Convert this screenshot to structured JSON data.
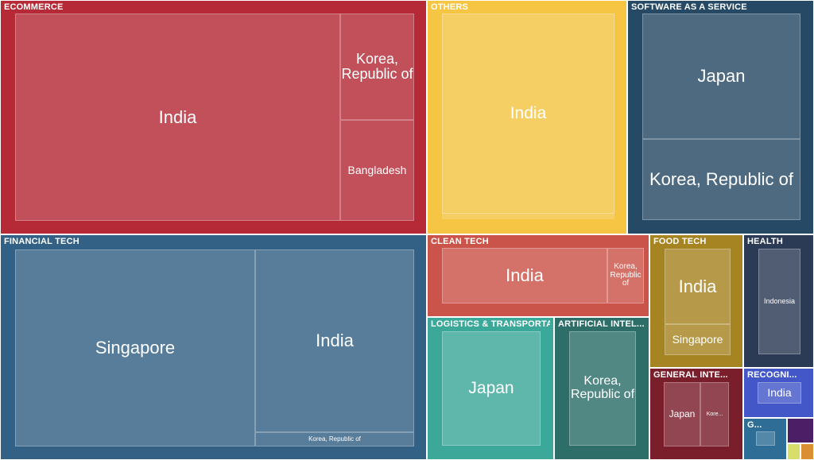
{
  "chart_data": {
    "type": "treemap",
    "colors": {
      "ECOMMERCE": "#b52a36",
      "OTHERS": "#f5c543",
      "SOFTWARE AS A SERVICE": "#264a66",
      "FINANCIAL TECH": "#336186",
      "CLEAN TECH": "#cb544a",
      "FOOD TECH": "#a68422",
      "HEALTH": "#2b3a55",
      "LOGISTICS & TRANSPORTATION": "#3ca89a",
      "ARTIFICIAL INTELLIGENCE": "#2d6e68",
      "GENERAL INTERNET": "#7b1e2c",
      "RECOGNITION": "#4357c9",
      "G": "#2e6e96",
      "PURPLE": "#4b1e66",
      "LIME": "#d7df6a",
      "ORANGE": "#d98f32"
    },
    "groups": [
      {
        "key": "ECOMMERCE",
        "title": "ECOMMERCE",
        "leaves": [
          {
            "label": "India"
          },
          {
            "label": "Korea, Republic of"
          },
          {
            "label": "Bangladesh"
          }
        ]
      },
      {
        "key": "OTHERS",
        "title": "OTHERS",
        "leaves": [
          {
            "label": "India"
          }
        ]
      },
      {
        "key": "SOFTWARE AS A SERVICE",
        "title": "SOFTWARE AS A SERVICE",
        "leaves": [
          {
            "label": "Japan"
          },
          {
            "label": "Korea, Republic of"
          }
        ]
      },
      {
        "key": "FINANCIAL TECH",
        "title": "FINANCIAL TECH",
        "leaves": [
          {
            "label": "Singapore"
          },
          {
            "label": "India"
          },
          {
            "label": "Korea, Republic of"
          }
        ]
      },
      {
        "key": "CLEAN TECH",
        "title": "CLEAN TECH",
        "leaves": [
          {
            "label": "India"
          },
          {
            "label": "Korea, Republic of"
          }
        ]
      },
      {
        "key": "FOOD TECH",
        "title": "FOOD TECH",
        "leaves": [
          {
            "label": "India"
          },
          {
            "label": "Singapore"
          }
        ]
      },
      {
        "key": "HEALTH",
        "title": "HEALTH",
        "leaves": [
          {
            "label": "Indonesia"
          }
        ]
      },
      {
        "key": "LOGISTICS & TRANSPORTATION",
        "title": "LOGISTICS & TRANSPORTATION",
        "leaves": [
          {
            "label": "Japan"
          }
        ]
      },
      {
        "key": "ARTIFICIAL INTELLIGENCE",
        "title": "ARTIFICIAL INTELLIGENCE",
        "leaves": [
          {
            "label": "Korea, Republic of"
          }
        ]
      },
      {
        "key": "GENERAL INTERNET",
        "title": "GENERAL INTERNET",
        "leaves": [
          {
            "label": "Japan"
          },
          {
            "label": "Korea, Republic of"
          }
        ]
      },
      {
        "key": "RECOGNITION",
        "title": "RECOGNITION",
        "leaves": [
          {
            "label": "India"
          }
        ]
      },
      {
        "key": "G",
        "title": "G...",
        "leaves": [
          {
            "label": ""
          }
        ]
      },
      {
        "key": "PURPLE",
        "title": "",
        "leaves": []
      },
      {
        "key": "LIME",
        "title": "",
        "leaves": []
      },
      {
        "key": "ORANGE",
        "title": "",
        "leaves": []
      }
    ]
  }
}
